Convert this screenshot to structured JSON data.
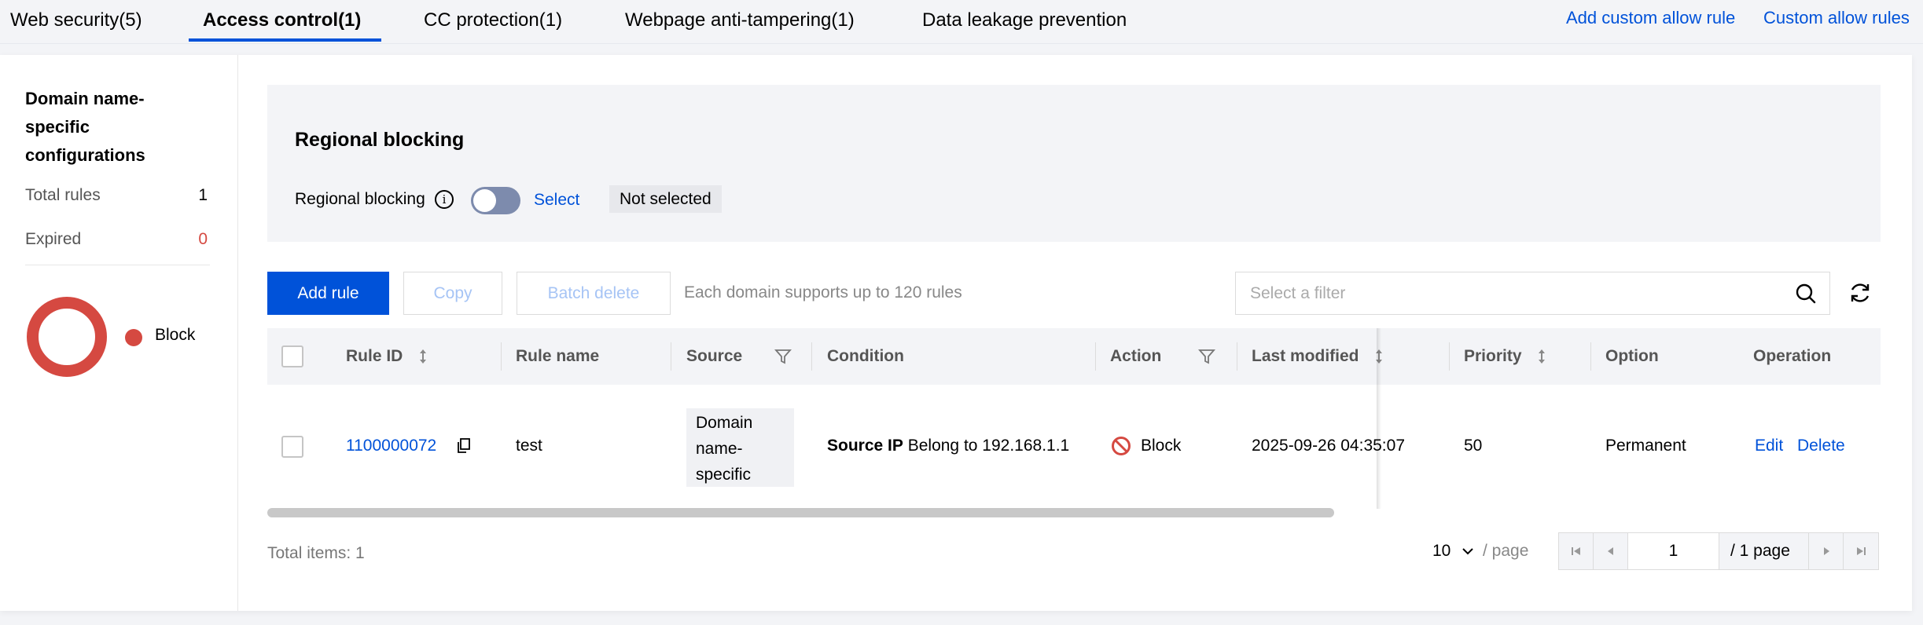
{
  "tabs": [
    {
      "label": "Web security(5)"
    },
    {
      "label": "Access control(1)"
    },
    {
      "label": "CC protection(1)"
    },
    {
      "label": "Webpage anti-tampering(1)"
    },
    {
      "label": "Data leakage prevention"
    }
  ],
  "active_tab": "Access control(1)",
  "top_links": {
    "add_custom_allow_rule": "Add custom allow rule",
    "custom_allow_rules": "Custom allow rules"
  },
  "left_panel": {
    "title": "Domain name-specific configurations",
    "total_rules_label": "Total rules",
    "total_rules_value": "1",
    "expired_label": "Expired",
    "expired_value": "0",
    "legend_label": "Block",
    "colors": {
      "block": "#d54941",
      "expired_value": "#d54941"
    }
  },
  "regional_blocking": {
    "title": "Regional blocking",
    "label": "Regional blocking",
    "toggle_on": false,
    "select_label": "Select",
    "status": "Not selected"
  },
  "toolbar": {
    "add_rule": "Add rule",
    "copy": "Copy",
    "batch_delete": "Batch delete",
    "hint": "Each domain supports up to 120 rules",
    "filter_placeholder": "Select a filter"
  },
  "table": {
    "columns": {
      "rule_id": "Rule ID",
      "rule_name": "Rule name",
      "source": "Source",
      "condition": "Condition",
      "action": "Action",
      "last_modified": "Last modified",
      "priority": "Priority",
      "option": "Option",
      "operation": "Operation"
    },
    "rows": [
      {
        "rule_id": "1100000072",
        "rule_name": "test",
        "source": "Domain name-specific",
        "condition_field": "Source IP",
        "condition_text": "Belong to 192.168.1.1",
        "action": "Block",
        "last_modified": "2025-09-26 04:35:07",
        "priority": "50",
        "option": "Permanent",
        "edit": "Edit",
        "delete": "Delete"
      }
    ]
  },
  "footer": {
    "total_items": "Total items: 1",
    "page_size": "10",
    "per_page": "/ page",
    "current_page": "1",
    "total_pages": "/ 1 page"
  },
  "accent_color": "#0052d9"
}
